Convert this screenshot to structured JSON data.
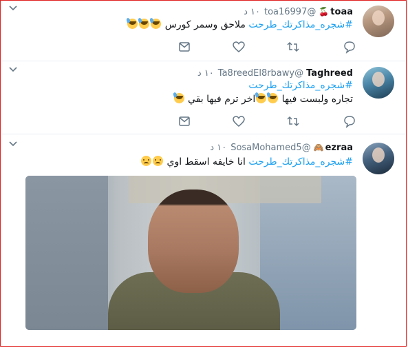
{
  "tweets": [
    {
      "name": "toaa",
      "name_emoji": "🍒",
      "handle": "@toa16997",
      "time": "١٠ د",
      "hashtag": "#شجره_مذاكرتك_طرحت",
      "text": "ملاحق وسمر كورس",
      "emojis": [
        "smiling-face-with-sweat",
        "smiling-face-with-sweat",
        "smiling-face-with-sweat"
      ]
    },
    {
      "name": "Taghreed",
      "handle": "@Ta8reedEl8rbawy",
      "time": "١٠ د",
      "hashtag": "#شجره_مذاكرتك_طرحت",
      "text_part1": "تجاره ولبست فيها",
      "text_part2": "اخر ترم فيها بقي",
      "emojis": [
        "smiling-face-with-sweat",
        "smiling-face-with-sweat",
        "smiling-face-with-sweat"
      ]
    },
    {
      "name": "ezraa",
      "name_emoji": "🙈",
      "handle": "@SosaMohamed5",
      "time": "١٠ د",
      "hashtag": "#شجره_مذاكرتك_طرحت",
      "text": "انا خايفه اسقط اوي",
      "emojis": [
        "disappointed-face",
        "disappointed-face"
      ]
    }
  ],
  "colors": {
    "link": "#1da1f2",
    "muted": "#657786",
    "text": "#14171a"
  }
}
